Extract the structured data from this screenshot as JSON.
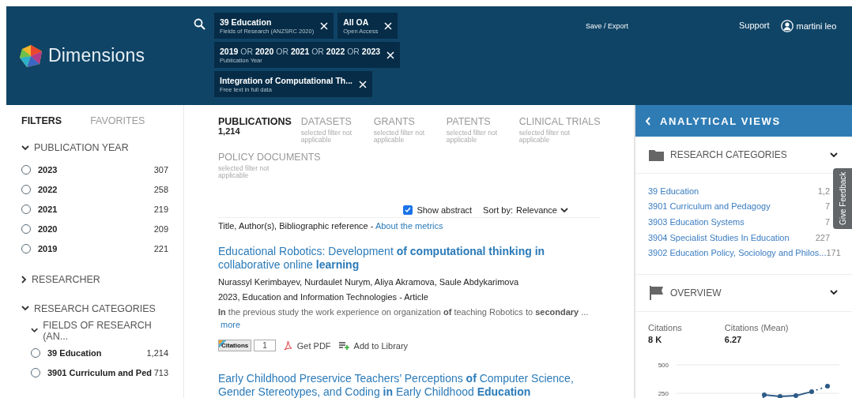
{
  "header": {
    "logo": "Dimensions",
    "chips": [
      {
        "kind": "single",
        "label": "39 Education",
        "sublabel": "Fields of Research (ANZSRC 2020)"
      },
      {
        "kind": "single",
        "label": "All OA",
        "sublabel": "Open Access"
      },
      {
        "kind": "or-list",
        "label": "**2019** OR **2020** OR **2021** OR **2022** OR **2023**",
        "sublabel": "Publication Year"
      },
      {
        "kind": "single",
        "label": "Integration of Computational Th...",
        "sublabel": "Free text in full data"
      }
    ],
    "save_export": "Save / Export",
    "support": "Support",
    "user": "martini leo"
  },
  "filters": {
    "tabs": [
      {
        "label": "FILTERS",
        "selected": true
      },
      {
        "label": "FAVORITES",
        "selected": false
      }
    ],
    "sections": [
      {
        "title": "PUBLICATION YEAR",
        "expanded": true,
        "items": [
          {
            "label": "2023",
            "count": "307",
            "selected": false
          },
          {
            "label": "2022",
            "count": "258",
            "selected": false
          },
          {
            "label": "2021",
            "count": "219",
            "selected": false
          },
          {
            "label": "2020",
            "count": "209",
            "selected": false
          },
          {
            "label": "2019",
            "count": "221",
            "selected": false
          }
        ]
      },
      {
        "title": "RESEARCHER",
        "expanded": false
      },
      {
        "title": "RESEARCH CATEGORIES",
        "expanded": true,
        "children": [
          {
            "title": "FIELDS OF RESEARCH (AN...",
            "expanded": true,
            "items": [
              {
                "label": "39 Education",
                "count": "1,214",
                "selected": false
              },
              {
                "label": "3901 Curriculum and Ped",
                "count": "713",
                "selected": false
              }
            ]
          }
        ]
      }
    ]
  },
  "results": {
    "tabs": [
      {
        "label": "PUBLICATIONS",
        "sub": "1,214",
        "selected": true
      },
      {
        "label": "DATASETS",
        "sub": "selected filter not applicable",
        "selected": false
      },
      {
        "label": "GRANTS",
        "sub": "selected filter not applicable",
        "selected": false
      },
      {
        "label": "PATENTS",
        "sub": "selected filter not applicable",
        "selected": false
      },
      {
        "label": "CLINICAL TRIALS",
        "sub": "selected filter not applicable",
        "selected": false
      },
      {
        "label": "POLICY DOCUMENTS",
        "sub": "selected filter not applicable",
        "selected": false
      }
    ],
    "show_abstract": {
      "label": "Show abstract",
      "checked": true
    },
    "sort": {
      "label": "Sort by:",
      "value": "Relevance"
    },
    "legend": {
      "text": "Title, Author(s), Bibliographic reference -",
      "link": "About the metrics"
    },
    "items": [
      {
        "title": "Educational Robotics: Development **of computational thinking in** collaborative online **learning**",
        "authors": "Nurassyl Kerimbayev, Nurdaulet Nurym, Aliya Akramova, Saule Abdykarimova",
        "reference": "2023, Education and Information Technologies - Article",
        "abstract": "**In** the previous study the work experience on organization **of** teaching Robotics to **secondary** ...",
        "more": "more",
        "citations_label": "Citations",
        "citations": "1",
        "pdf": "Get PDF",
        "library": "Add to Library"
      },
      {
        "title": "Early Childhood Preservice Teachers’ Perceptions **of** Computer Science, Gender Stereotypes, and Coding **in** Early Childhood **Education**"
      }
    ]
  },
  "analytics": {
    "title": "ANALYTICAL VIEWS",
    "sections": [
      {
        "kind": "categories",
        "title": "RESEARCH CATEGORIES",
        "expanded": true,
        "items": [
          {
            "label": "39 Education",
            "count": "1,2"
          },
          {
            "label": "3901 Curriculum and Pedagogy",
            "count": "7"
          },
          {
            "label": "3903 Education Systems",
            "count": "7"
          },
          {
            "label": "3904 Specialist Studies In Education",
            "count": "227"
          },
          {
            "label": "3902 Education Policy, Sociology and Philos...",
            "count": "171"
          }
        ]
      },
      {
        "kind": "overview",
        "title": "OVERVIEW",
        "expanded": true,
        "metrics": [
          {
            "label": "Citations",
            "value": "8 K"
          },
          {
            "label": "Citations (Mean)",
            "value": "6.27"
          }
        ],
        "chart_ticks": [
          "500",
          "250"
        ]
      }
    ],
    "feedback": "Give Feedback"
  }
}
